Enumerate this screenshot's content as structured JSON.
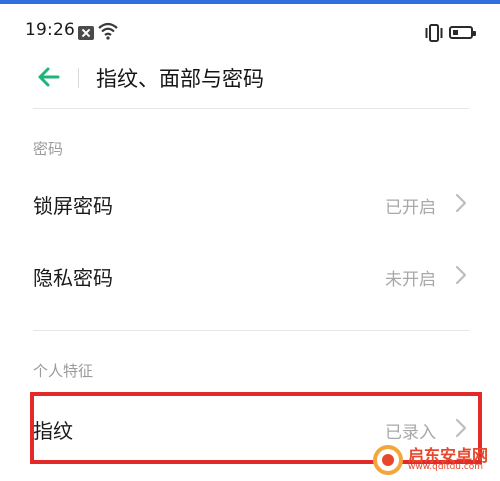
{
  "status_bar": {
    "time": "19:26",
    "icons": [
      "notification-x-icon",
      "wifi-icon",
      "vibrate-icon",
      "battery-icon"
    ]
  },
  "header": {
    "title": "指纹、面部与密码",
    "back_icon": "arrow-left-icon",
    "accent_color": "#1db67a"
  },
  "sections": {
    "password": {
      "label": "密码",
      "items": [
        {
          "label": "锁屏密码",
          "value": "已开启"
        },
        {
          "label": "隐私密码",
          "value": "未开启"
        }
      ]
    },
    "personal": {
      "label": "个人特征",
      "items": [
        {
          "label": "指纹",
          "value": "已录入"
        }
      ]
    }
  },
  "annotation": {
    "color": "#e32a2a"
  },
  "watermark": {
    "name": "启东安卓网",
    "url": "www.qdltdu.com"
  }
}
